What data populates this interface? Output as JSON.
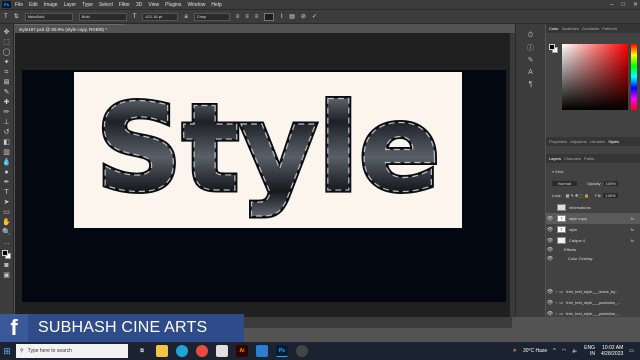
{
  "menu": [
    "File",
    "Edit",
    "Image",
    "Layer",
    "Type",
    "Select",
    "Filter",
    "3D",
    "View",
    "Plugins",
    "Window",
    "Help"
  ],
  "app_logo": "Ps",
  "options": {
    "font_family": "MeloBold",
    "font_style": "Bold",
    "font_size": "421.16 pt",
    "antialias": "Crisp"
  },
  "document_tab": "style187.psd @ 80.9% (style copy, RGB/8) *",
  "canvas_text": "Style",
  "color_panel_tabs": [
    "Color",
    "Swatches",
    "Gradients",
    "Patterns"
  ],
  "properties_tabs": [
    "Properties",
    "Adjustme",
    "Libraries",
    "Styles"
  ],
  "layers_tabs": [
    "Layers",
    "Channels",
    "Paths"
  ],
  "layers_controls": {
    "blend_mode": "Normal",
    "opacity_label": "Opacity:",
    "opacity_value": "100%",
    "lock_label": "Lock:",
    "fill_label": "Fill:",
    "fill_value": "100%"
  },
  "layers": [
    {
      "name": "informations",
      "fx": ""
    },
    {
      "name": "style copy",
      "fx": "fx"
    },
    {
      "name": "style",
      "fx": "fx"
    },
    {
      "name": "Calque 4",
      "fx": "fx"
    },
    {
      "name": "Effects",
      "fx": ""
    },
    {
      "name": "Color Overlay",
      "fx": ""
    }
  ],
  "bottom_layers": [
    {
      "name": "free_text_style___mobe_by..."
    },
    {
      "name": "free_text_style___poseidon_..."
    },
    {
      "name": "free_text_style___poseidon_..."
    }
  ],
  "banner": {
    "brand": "SUBHASH CINE ARTS",
    "logo": "f"
  },
  "taskbar": {
    "search_placeholder": "Type here to search",
    "weather": "30°C  Haze",
    "lang": "ENG",
    "region": "IN",
    "time": "10:02 AM",
    "date": "4/28/2023"
  }
}
